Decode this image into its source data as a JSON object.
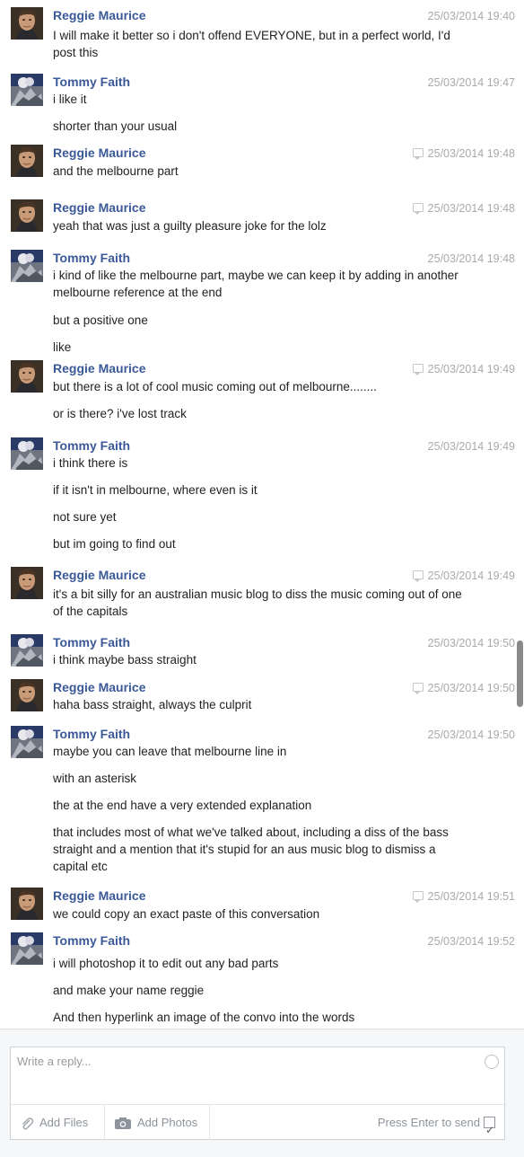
{
  "messages": [
    {
      "sender": "Reggie Maurice",
      "avatar": "reggie",
      "timestamp": "25/03/2014 19:40",
      "seen": false,
      "lines": [
        "I will make it better so i don't offend EVERYONE, but in a perfect world, I'd post this"
      ]
    },
    {
      "sender": "Tommy Faith",
      "avatar": "tommy",
      "timestamp": "25/03/2014 19:47",
      "seen": false,
      "lines": [
        "i like it",
        "shorter than your usual"
      ]
    },
    {
      "sender": "Reggie Maurice",
      "avatar": "reggie",
      "timestamp": "25/03/2014 19:48",
      "seen": true,
      "lines": [
        "and the melbourne part"
      ]
    },
    {
      "sender": "Reggie Maurice",
      "avatar": "reggie",
      "timestamp": "25/03/2014 19:48",
      "seen": true,
      "lines": [
        "yeah that was just a guilty pleasure joke for the lolz"
      ]
    },
    {
      "sender": "Tommy Faith",
      "avatar": "tommy",
      "timestamp": "25/03/2014 19:48",
      "seen": false,
      "lines": [
        "i kind of like the melbourne part, maybe we can keep it by adding in another melbourne reference at the end",
        "but a positive one",
        "like"
      ]
    },
    {
      "sender": "Reggie Maurice",
      "avatar": "reggie",
      "timestamp": "25/03/2014 19:49",
      "seen": true,
      "lines": [
        "but there is a lot of cool music coming out of melbourne........",
        "or is there? i've lost track"
      ]
    },
    {
      "sender": "Tommy Faith",
      "avatar": "tommy",
      "timestamp": "25/03/2014 19:49",
      "seen": false,
      "lines": [
        "i think there is",
        "if it isn't in melbourne, where even is it",
        "not sure yet",
        "but im going to find out"
      ]
    },
    {
      "sender": "Reggie Maurice",
      "avatar": "reggie",
      "timestamp": "25/03/2014 19:49",
      "seen": true,
      "lines": [
        "it's a bit silly for an australian music blog to diss the music coming out of one of the capitals"
      ]
    },
    {
      "sender": "Tommy Faith",
      "avatar": "tommy",
      "timestamp": "25/03/2014 19:50",
      "seen": false,
      "lines": [
        "i think maybe bass straight"
      ]
    },
    {
      "sender": "Reggie Maurice",
      "avatar": "reggie",
      "timestamp": "25/03/2014 19:50",
      "seen": true,
      "lines": [
        "haha bass straight, always the culprit"
      ]
    },
    {
      "sender": "Tommy Faith",
      "avatar": "tommy",
      "timestamp": "25/03/2014 19:50",
      "seen": false,
      "lines": [
        "maybe you can leave that melbourne line in",
        "with an asterisk",
        "the at the end have a very extended explanation",
        "that includes most of what we've talked about, including a diss of the bass straight and a mention that it's stupid for an aus music blog to dismiss a capital etc"
      ]
    },
    {
      "sender": "Reggie Maurice",
      "avatar": "reggie",
      "timestamp": "25/03/2014 19:51",
      "seen": true,
      "lines": [
        "we could copy an exact paste of this conversation"
      ]
    },
    {
      "sender": "Tommy Faith",
      "avatar": "tommy",
      "timestamp": "25/03/2014 19:52",
      "seen": false,
      "lines": [
        "i will photoshop it to edit out any bad parts",
        "and make your name reggie",
        "And then hyperlink an image of the convo into the words"
      ]
    }
  ],
  "composer": {
    "placeholder": "Write a reply...",
    "add_files": "Add Files",
    "add_photos": "Add Photos",
    "press_enter": "Press Enter to send",
    "press_enter_checked": true
  },
  "colors": {
    "name": "#3b5998",
    "meta": "#aaaaaa",
    "text": "#222222"
  },
  "icons": [
    "seen-icon",
    "paperclip-icon",
    "camera-icon",
    "smiley-icon",
    "checkbox-icon"
  ]
}
